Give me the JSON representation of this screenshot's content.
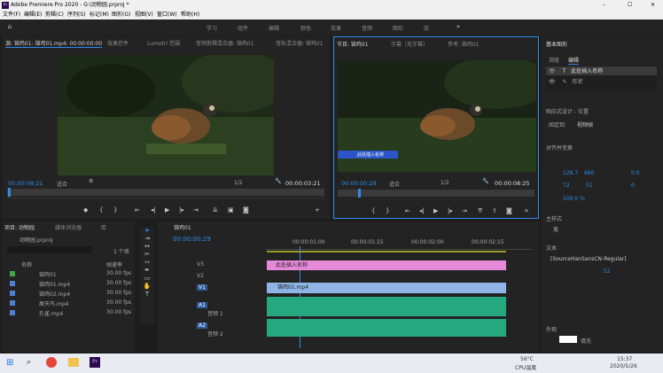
{
  "app": {
    "title": "Adobe Premiere Pro 2020 - G:\\动物园.prproj *",
    "min": "–",
    "max": "☐",
    "close": "✕"
  },
  "menu": [
    "文件(F)",
    "编辑(E)",
    "剪辑(C)",
    "序列(S)",
    "标记(M)",
    "图形(G)",
    "视图(V)",
    "窗口(W)",
    "帮助(H)"
  ],
  "workspaces": [
    "学习",
    "组件",
    "编辑",
    "颜色",
    "效果",
    "音频",
    "图形",
    "库"
  ],
  "source": {
    "tabs": [
      "源: 锦鸡01: 锦鸡01.mp4: 00:00:00:00",
      "效果控件",
      "Lumetri 范围",
      "音频剪辑混合器: 锦鸡01",
      "音轨混合器: 锦鸡01"
    ],
    "tc_left": "00:00:08:21",
    "fit": "适合",
    "ratio": "1/2",
    "tc_right": "00:00:03:21"
  },
  "program": {
    "tabs": [
      "节目: 锦鸡01",
      "字幕（无字幕）",
      "参考: 锦鸡01"
    ],
    "tc_left": "00:00:00:29",
    "fit": "适合",
    "ratio": "1/2",
    "tc_right": "00:00:08:25",
    "overlay": "此处插入名称"
  },
  "essential": {
    "title": "基本图形",
    "tabs": [
      "浏览",
      "编辑"
    ],
    "layers": [
      "此处插入名称",
      "形状"
    ],
    "responsive": "响应式设计 - 位置",
    "pin_label": "固定到",
    "pin_value": "视频帧",
    "align": "对齐并变换",
    "x": "128.7",
    "y": "960",
    "angle": "0.0",
    "scale": "72",
    "scale2": "51",
    "rot": "0",
    "opacity": "100.0 %",
    "master": "主样式",
    "master_val": "无",
    "text": "文本",
    "font": "[SourceHanSansCN-Regular]",
    "size": "52",
    "appearance": "外观",
    "fill": "填充"
  },
  "project": {
    "tabs": [
      "项目: 动物园",
      "媒体浏览器",
      "库"
    ],
    "name": "动物园.prproj",
    "count": "1 个项",
    "col_name": "名称",
    "col_fps": "帧速率",
    "items": [
      {
        "name": "锦鸡01",
        "fps": "30.00 fps",
        "color": "#3fa64a"
      },
      {
        "name": "锦鸡01.mp4",
        "fps": "30.00 fps",
        "color": "#4e7fd6"
      },
      {
        "name": "锦鸡02.mp4",
        "fps": "30.00 fps",
        "color": "#4e7fd6"
      },
      {
        "name": "犀天鸟.mp4",
        "fps": "30.00 fps",
        "color": "#4e7fd6"
      },
      {
        "name": "孔雀.mp4",
        "fps": "30.00 fps",
        "color": "#4e7fd6"
      }
    ]
  },
  "timeline": {
    "tab": "锦鸡01",
    "tc": "00:00:00:29",
    "ruler": [
      "00:00:01:00",
      "00:00:01:15",
      "00:00:02:00",
      "00:00:02:15"
    ],
    "tracks": [
      "V3",
      "V2",
      "V1",
      "A1",
      "A2"
    ],
    "mix": [
      "音频 1",
      "音频 2"
    ],
    "clip_title": "此处插入名称",
    "clip_video": "锦鸡01.mp4"
  },
  "taskbar": {
    "temp": "56°C",
    "cpu": "CPU温度",
    "time": "15:37",
    "date": "2020/5/26"
  },
  "colors": {
    "accent": "#2d8ceb",
    "title_clip": "#e58ad8",
    "video_clip": "#8fb4e6",
    "audio_clip": "#27a77e"
  }
}
